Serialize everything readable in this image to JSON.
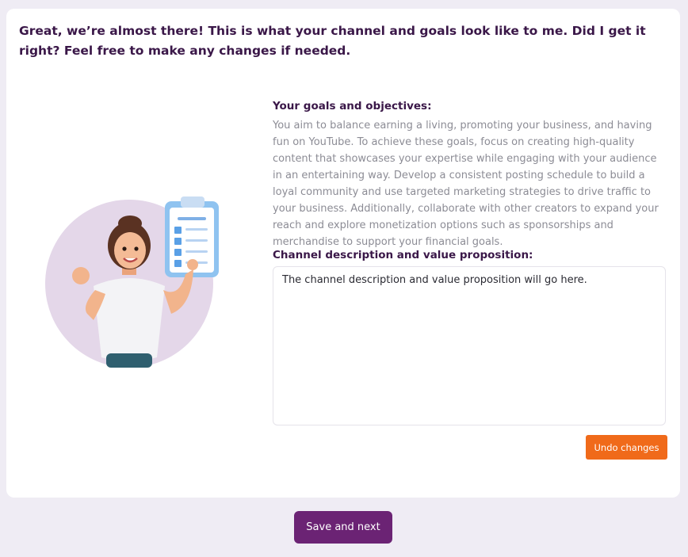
{
  "intro": {
    "text": "Great, we’re almost there! This is what your channel and goals look like to me. Did I get it right? Feel free to make any changes if needed."
  },
  "goals": {
    "heading": "Your goals and objectives:",
    "body": "You aim to balance earning a living, promoting your business, and having fun on YouTube. To achieve these goals, focus on creating high-quality content that showcases your expertise while engaging with your audience in an entertaining way. Develop a consistent posting schedule to build a loyal community and use targeted marketing strategies to drive traffic to your business. Additionally, collaborate with other creators to expand your reach and explore monetization options such as sponsorships and merchandise to support your financial goals."
  },
  "channel": {
    "heading": "Channel description and value proposition:",
    "value": "The channel description and value proposition will go here."
  },
  "buttons": {
    "undo": "Undo changes",
    "save": "Save and next"
  },
  "colors": {
    "background": "#efecf4",
    "heading": "#3a1748",
    "undo_button": "#f06a1a",
    "save_button": "#6b2374"
  }
}
